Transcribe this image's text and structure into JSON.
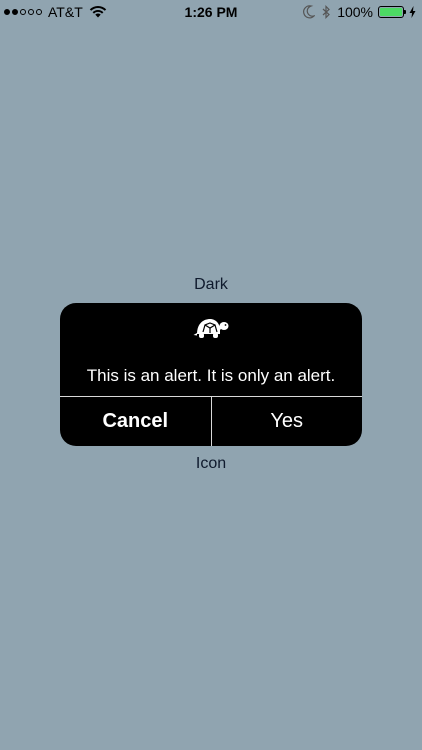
{
  "status_bar": {
    "carrier": "AT&T",
    "time": "1:26 PM",
    "battery_percent": "100%",
    "signal_filled": 2,
    "signal_total": 5,
    "battery_color": "#4cd964",
    "icons": [
      "signal-dots-icon",
      "wifi-icon",
      "moon-icon",
      "bluetooth-icon",
      "battery-icon",
      "charging-bolt-icon"
    ]
  },
  "labels": {
    "top": "Dark",
    "bottom": "Icon"
  },
  "alert": {
    "icon": "turtle-icon",
    "message": "This is an alert. It is only an alert.",
    "cancel_label": "Cancel",
    "confirm_label": "Yes",
    "background": "#000000",
    "text_color": "#ffffff"
  },
  "colors": {
    "page_background": "#90a4b0",
    "label_text": "#0f1a2d"
  }
}
